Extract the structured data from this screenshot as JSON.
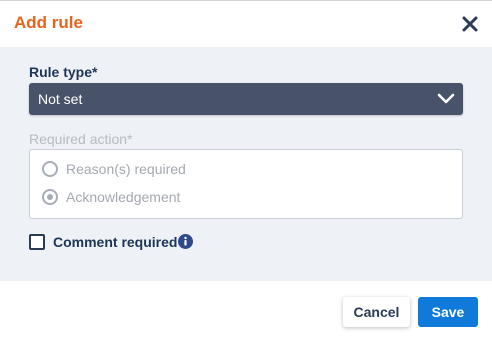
{
  "dialog": {
    "title": "Add rule",
    "close_icon": "close-icon"
  },
  "rule_type": {
    "label": "Rule type*",
    "selected": "Not set",
    "chevron_icon": "chevron-down-icon"
  },
  "required_action": {
    "label": "Required action*",
    "options": [
      {
        "label": "Reason(s) required",
        "selected": false
      },
      {
        "label": "Acknowledgement",
        "selected": true
      }
    ],
    "disabled": true
  },
  "comment_required": {
    "label": "Comment required",
    "checked": false,
    "info_icon": "info-icon"
  },
  "footer": {
    "cancel_label": "Cancel",
    "save_label": "Save"
  },
  "colors": {
    "title": "#e8631c",
    "select_bg": "#48536a",
    "primary": "#0f7ad9",
    "body_bg": "#eef1f5"
  }
}
